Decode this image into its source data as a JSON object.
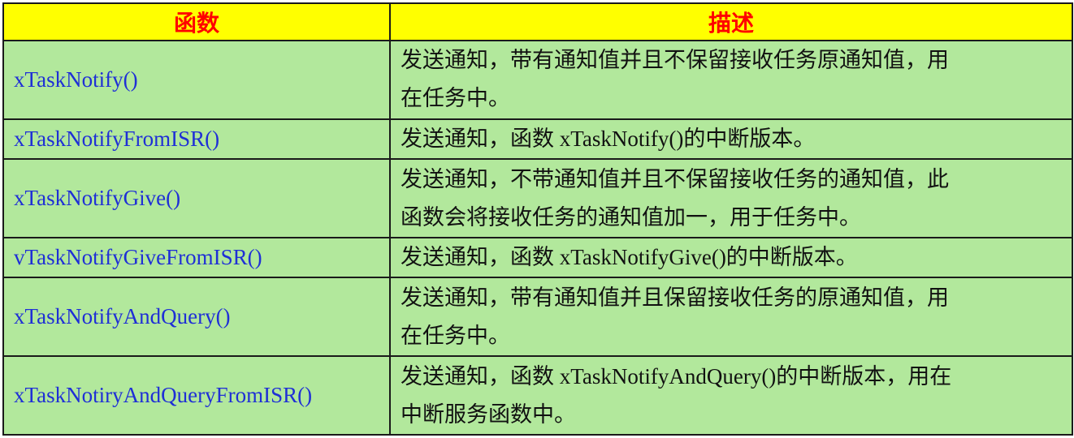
{
  "table": {
    "headers": [
      "函数",
      "描述"
    ],
    "rows": [
      {
        "function": "xTaskNotify()",
        "description_lines": [
          "发送通知，带有通知值并且不保留接收任务原通知值，用",
          "在任务中。"
        ]
      },
      {
        "function": "xTaskNotifyFromISR()",
        "description_lines": [
          "发送通知，函数 xTaskNotify()的中断版本。"
        ]
      },
      {
        "function": "xTaskNotifyGive()",
        "description_lines": [
          "发送通知，不带通知值并且不保留接收任务的通知值，此",
          "函数会将接收任务的通知值加一，用于任务中。"
        ]
      },
      {
        "function": "vTaskNotifyGiveFromISR()",
        "description_lines": [
          "发送通知，函数 xTaskNotifyGive()的中断版本。"
        ]
      },
      {
        "function": "xTaskNotifyAndQuery()",
        "description_lines": [
          "发送通知，带有通知值并且保留接收任务的原通知值，用",
          "在任务中。"
        ]
      },
      {
        "function": "xTaskNotiryAndQueryFromISR()",
        "description_lines": [
          "发送通知，函数 xTaskNotifyAndQuery()的中断版本，用在",
          "中断服务函数中。"
        ]
      }
    ]
  },
  "colors": {
    "header_bg": "#ffff00",
    "header_text": "#ff0000",
    "row_bg": "#b2e89c",
    "function_text": "#1f2fd6",
    "border": "#1a1a1a"
  }
}
